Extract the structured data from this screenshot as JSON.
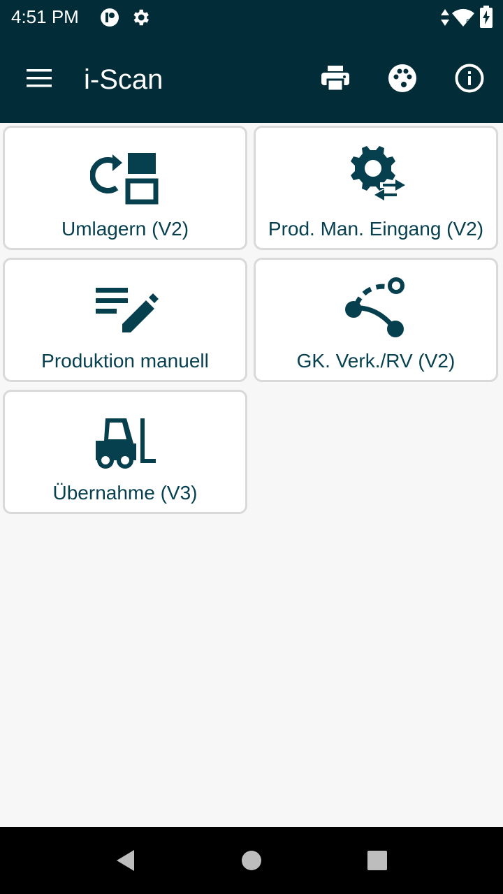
{
  "status_bar": {
    "time": "4:51 PM",
    "icons": [
      "app-notification-icon",
      "settings-icon",
      "data-arrows-icon",
      "wifi-icon",
      "battery-charging-icon"
    ]
  },
  "app_bar": {
    "title": "i-Scan",
    "menu_icon": "menu-icon",
    "actions": [
      "print-icon",
      "palette-icon",
      "info-icon"
    ],
    "background": "#022d38"
  },
  "tiles": [
    {
      "label": "Umlagern (V2)",
      "icon": "relocate-icon"
    },
    {
      "label": "Prod. Man. Eingang (V2)",
      "icon": "gear-exchange-icon"
    },
    {
      "label": "Produktion manuell",
      "icon": "edit-list-icon"
    },
    {
      "label": "GK. Verk./RV (V2)",
      "icon": "route-icon"
    },
    {
      "label": "Übernahme (V3)",
      "icon": "forklift-icon"
    }
  ],
  "nav_bar": {
    "buttons": [
      "back-icon",
      "home-icon",
      "recents-icon"
    ]
  },
  "colors": {
    "accent": "#063f4e",
    "tile_border": "#d9d9d9",
    "background": "#f7f7f7"
  }
}
